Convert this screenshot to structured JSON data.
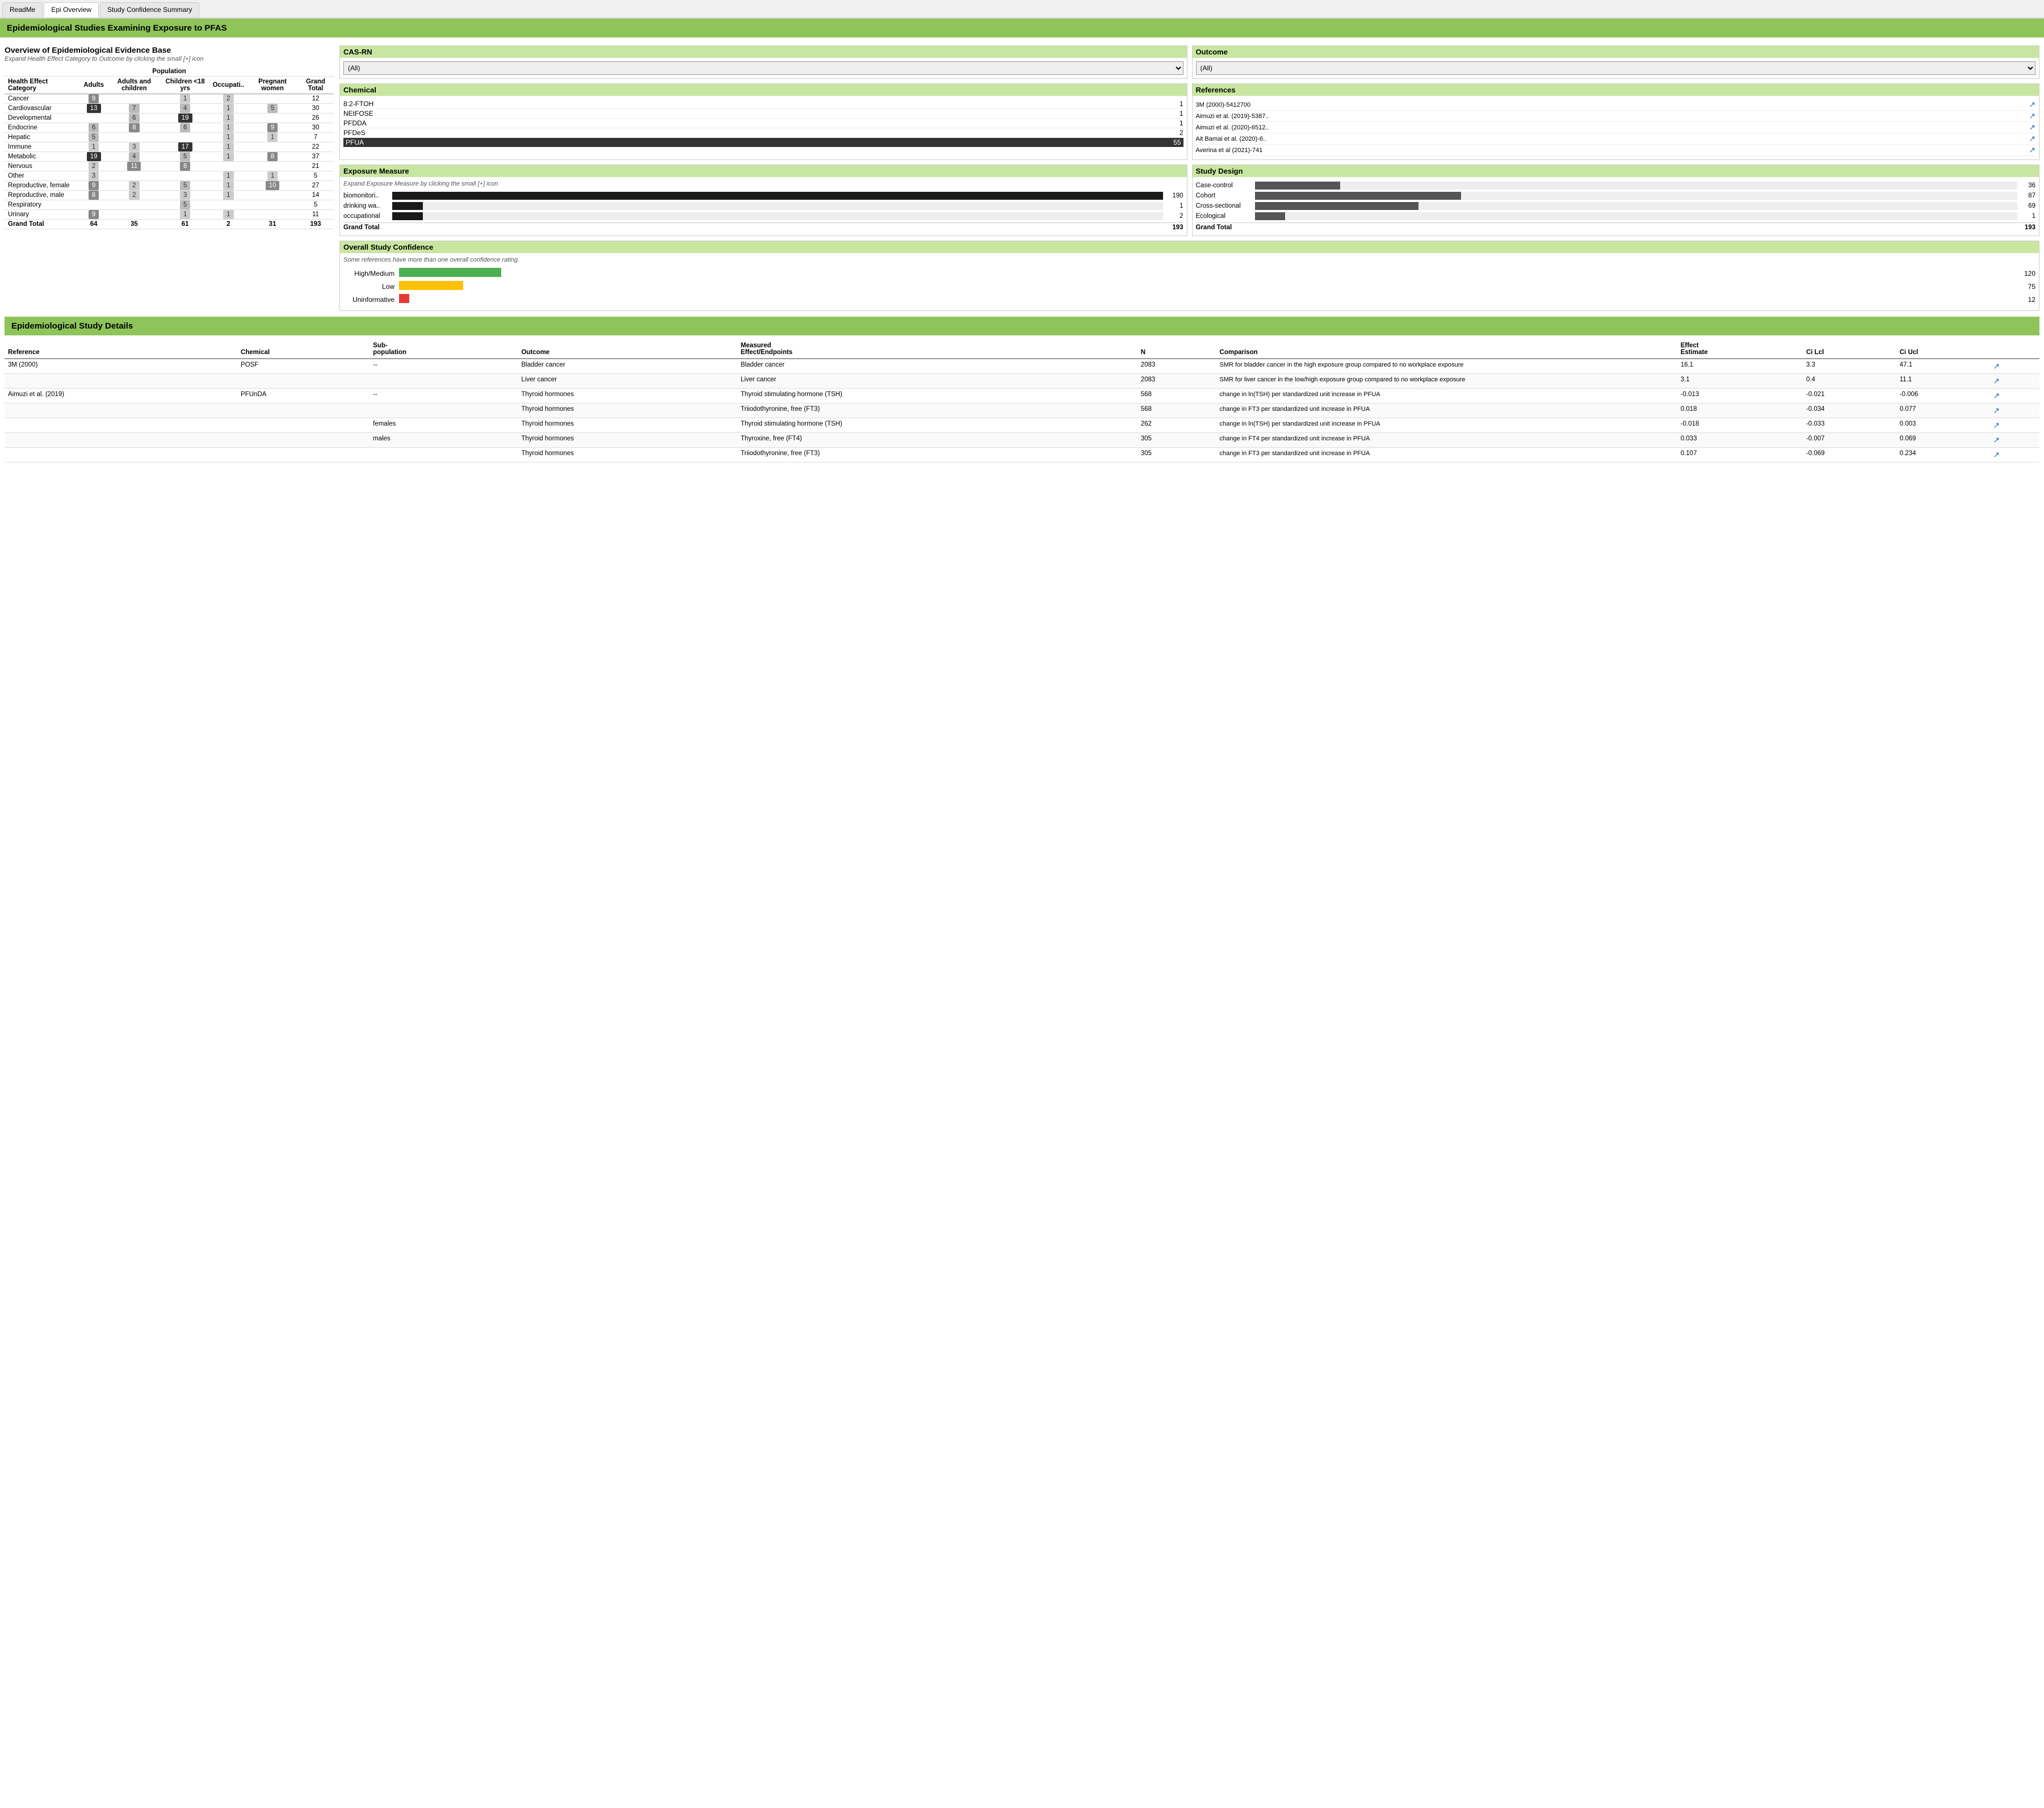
{
  "tabs": [
    {
      "label": "ReadMe",
      "active": false
    },
    {
      "label": "Epi Overview",
      "active": true
    },
    {
      "label": "Study Confidence Summary",
      "active": false
    }
  ],
  "main_header": "Epidemiological Studies Examining Exposure to PFAS",
  "left_panel": {
    "title": "Overview of Epidemiological Evidence Base",
    "subtitle": "Expand Health Effect Category to Outcome by clicking the small [+] icon",
    "population_header": "Population",
    "columns": [
      "Health Effect Category",
      "Adults",
      "Adults and children",
      "Children <18 yrs",
      "Occupati..",
      "Pregnant women",
      "Grand Total"
    ]
  },
  "table_rows": [
    {
      "category": "Cancer",
      "adults": "9",
      "adults_children": "",
      "children": "1",
      "occupational": "2",
      "pregnant": "",
      "total": "12",
      "adults_style": "med",
      "children_style": "none",
      "occupational_style": "none"
    },
    {
      "category": "Cardiovascular",
      "adults": "13",
      "adults_children": "7",
      "children": "4",
      "occupational": "1",
      "pregnant": "5",
      "total": "30",
      "adults_style": "dark",
      "children_style": "light",
      "occupational_style": "none"
    },
    {
      "category": "Developmental",
      "adults": "",
      "adults_children": "6",
      "children": "19",
      "occupational": "1",
      "pregnant": "",
      "total": "26",
      "children_style": "black"
    },
    {
      "category": "Endocrine",
      "adults": "6",
      "adults_children": "8",
      "children": "6",
      "occupational": "1",
      "pregnant": "9",
      "total": "30"
    },
    {
      "category": "Hepatic",
      "adults": "5",
      "adults_children": "",
      "children": "",
      "occupational": "1",
      "pregnant": "1",
      "total": "7"
    },
    {
      "category": "Immune",
      "adults": "1",
      "adults_children": "3",
      "children": "17",
      "occupational": "1",
      "pregnant": "",
      "total": "22",
      "children_style": "black"
    },
    {
      "category": "Metabolic",
      "adults": "19",
      "adults_children": "4",
      "children": "5",
      "occupational": "1",
      "pregnant": "8",
      "total": "37",
      "adults_style": "black"
    },
    {
      "category": "Nervous",
      "adults": "2",
      "adults_children": "11",
      "children": "8",
      "occupational": "",
      "pregnant": "",
      "total": "21"
    },
    {
      "category": "Other",
      "adults": "3",
      "adults_children": "",
      "children": "",
      "occupational": "1",
      "pregnant": "1",
      "total": "5"
    },
    {
      "category": "Reproductive, female",
      "adults": "9",
      "adults_children": "2",
      "children": "5",
      "occupational": "1",
      "pregnant": "10",
      "total": "27"
    },
    {
      "category": "Reproductive, male",
      "adults": "8",
      "adults_children": "2",
      "children": "3",
      "occupational": "1",
      "pregnant": "",
      "total": "14"
    },
    {
      "category": "Respiratory",
      "adults": "",
      "adults_children": "",
      "children": "5",
      "occupational": "",
      "pregnant": "",
      "total": "5"
    },
    {
      "category": "Urinary",
      "adults": "9",
      "adults_children": "",
      "children": "1",
      "occupational": "1",
      "pregnant": "",
      "total": "11"
    },
    {
      "category": "Grand Total",
      "adults": "64",
      "adults_children": "35",
      "children": "61",
      "occupational": "2",
      "pregnant": "31",
      "total": "193",
      "is_total": true
    }
  ],
  "cas_rn": {
    "title": "CAS-RN",
    "options": [
      "(All)"
    ],
    "selected": "(All)"
  },
  "outcome": {
    "title": "Outcome",
    "options": [
      "(All)"
    ],
    "selected": "(All)"
  },
  "chemical": {
    "title": "Chemical",
    "items": [
      {
        "name": "8:2-FTOH",
        "count": "1"
      },
      {
        "name": "NEtFOSE",
        "count": "1"
      },
      {
        "name": "PFDDA",
        "count": "1"
      },
      {
        "name": "PFDeS",
        "count": "2"
      },
      {
        "name": "PFUA",
        "count": "55",
        "highlighted": true
      }
    ]
  },
  "references": {
    "title": "References",
    "items": [
      {
        "name": "3M (2000)-5412700"
      },
      {
        "name": "Aimuzi et al. (2019)-5387.."
      },
      {
        "name": "Aimuzi et al. (2020)-6512.."
      },
      {
        "name": "Ait Bamai et al. (2020)-6.."
      },
      {
        "name": "Averina et al (2021)-741"
      }
    ]
  },
  "exposure_measure": {
    "title": "Exposure Measure",
    "subtitle": "Expand Exposure Measure by clicking the small [+] icon",
    "items": [
      {
        "name": "biomonitori..",
        "value": 190,
        "max": 193
      },
      {
        "name": "drinking wa..",
        "value": 1,
        "max": 193
      },
      {
        "name": "occupational",
        "value": 2,
        "max": 193
      },
      {
        "name": "Grand Total",
        "value": 193,
        "max": 193,
        "is_total": true
      }
    ]
  },
  "study_design": {
    "title": "Study Design",
    "items": [
      {
        "name": "Case-control",
        "value": 36,
        "max": 193
      },
      {
        "name": "Cohort",
        "value": 87,
        "max": 193
      },
      {
        "name": "Cross-sectional",
        "value": 69,
        "max": 193
      },
      {
        "name": "Ecological",
        "value": 1,
        "max": 193
      },
      {
        "name": "Grand Total",
        "value": 193,
        "max": 193,
        "is_total": true
      }
    ]
  },
  "overall_confidence": {
    "title": "Overall Study Confidence",
    "subtitle": "Some references have more than one overall confidence rating.",
    "items": [
      {
        "label": "High/Medium",
        "value": 120,
        "max": 120,
        "color": "#4caf50"
      },
      {
        "label": "Low",
        "value": 75,
        "max": 120,
        "color": "#ffc107"
      },
      {
        "label": "Uninformative",
        "value": 12,
        "max": 120,
        "color": "#e53935"
      }
    ]
  },
  "details_section": {
    "title": "Epidemiological Study Details",
    "columns": [
      "Reference",
      "Chemical",
      "Sub-population",
      "Outcome",
      "Measured Effect/Endpoints",
      "N",
      "Comparison",
      "Effect Estimate",
      "Ci Lcl",
      "Ci Ucl",
      ""
    ]
  },
  "details_rows": [
    {
      "reference": "3M (2000)",
      "chemical": "POSF",
      "subpopulation": "--",
      "outcome": "Bladder cancer",
      "endpoint": "Bladder cancer",
      "n": "2083",
      "comparison": "SMR for bladder cancer in the high exposure group compared to no workplace exposure",
      "effect": "16.1",
      "ci_lcl": "3.3",
      "ci_ucl": "47.1"
    },
    {
      "reference": "",
      "chemical": "",
      "subpopulation": "",
      "outcome": "Liver cancer",
      "endpoint": "Liver cancer",
      "n": "2083",
      "comparison": "SMR for liver cancer in the low/high exposure group compared to no workplace exposure",
      "effect": "3.1",
      "ci_lcl": "0.4",
      "ci_ucl": "11.1"
    },
    {
      "reference": "Aimuzi et al. (2019)",
      "chemical": "PFUnDA",
      "subpopulation": "--",
      "outcome": "Thyroid hormones",
      "endpoint": "Thyroid stimulating hormone (TSH)",
      "n": "568",
      "comparison": "change in ln(TSH) per standardized unit increase in PFUA",
      "effect": "-0.013",
      "ci_lcl": "-0.021",
      "ci_ucl": "-0.006"
    },
    {
      "reference": "",
      "chemical": "",
      "subpopulation": "",
      "outcome": "Thyroid hormones",
      "endpoint": "Triiodothyronine, free (FT3)",
      "n": "568",
      "comparison": "change in FT3 per standardized unit increase in PFUA",
      "effect": "0.018",
      "ci_lcl": "-0.034",
      "ci_ucl": "0.077"
    },
    {
      "reference": "",
      "chemical": "",
      "subpopulation": "females",
      "outcome": "Thyroid hormones",
      "endpoint": "Thyroid stimulating hormone (TSH)",
      "n": "262",
      "comparison": "change in ln(TSH) per standardized unit increase in PFUA",
      "effect": "-0.018",
      "ci_lcl": "-0.033",
      "ci_ucl": "0.003"
    },
    {
      "reference": "",
      "chemical": "",
      "subpopulation": "males",
      "outcome": "Thyroid hormones",
      "endpoint": "Thyroxine, free (FT4)",
      "n": "305",
      "comparison": "change in FT4 per standardized unit increase in PFUA",
      "effect": "0.033",
      "ci_lcl": "-0.007",
      "ci_ucl": "0.069"
    },
    {
      "reference": "",
      "chemical": "",
      "subpopulation": "",
      "outcome": "Thyroid hormones",
      "endpoint": "Triiodothyronine, free (FT3)",
      "n": "305",
      "comparison": "change in FT3 per standardized unit increase in PFUA",
      "effect": "0.107",
      "ci_lcl": "-0.069",
      "ci_ucl": "0.234"
    }
  ]
}
